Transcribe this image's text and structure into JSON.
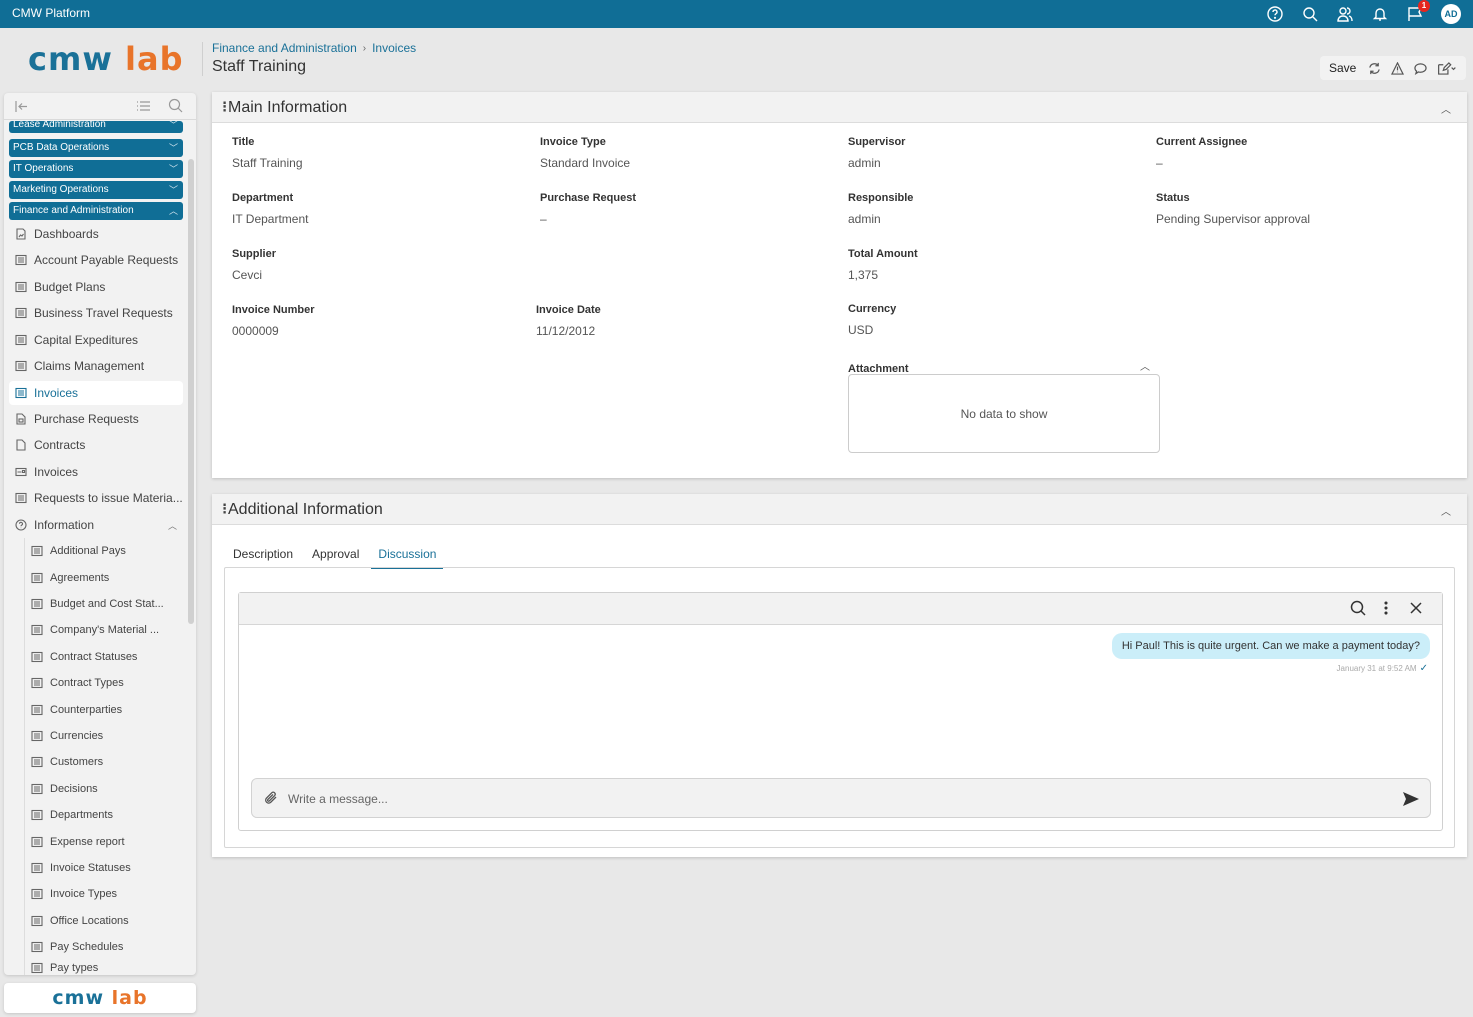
{
  "topbar": {
    "app_title": "CMW Platform",
    "icons": [
      "help-icon",
      "search-icon",
      "users-icon",
      "bell-icon",
      "flag-icon"
    ],
    "notification_count": "1",
    "avatar_initials": "AD"
  },
  "logo": {
    "part1": "cmw",
    "part2": "lab"
  },
  "breadcrumb": {
    "items": [
      "Finance and Administration",
      "Invoices"
    ],
    "separator": "›"
  },
  "page_title": "Staff Training",
  "actions": {
    "save_label": "Save"
  },
  "sidebar": {
    "groups": [
      {
        "label": "Lease Administration",
        "expanded": false
      },
      {
        "label": "PCB Data Operations",
        "expanded": false
      },
      {
        "label": "IT Operations",
        "expanded": false
      },
      {
        "label": "Marketing Operations",
        "expanded": false
      },
      {
        "label": "Finance and Administration",
        "expanded": true
      }
    ],
    "items": [
      {
        "label": "Dashboards",
        "icon": "dashboard-icon"
      },
      {
        "label": "Account Payable Requests",
        "icon": "list-icon"
      },
      {
        "label": "Budget Plans",
        "icon": "list-icon"
      },
      {
        "label": "Business Travel Requests",
        "icon": "list-icon"
      },
      {
        "label": "Capital Expeditures",
        "icon": "list-icon"
      },
      {
        "label": "Claims Management",
        "icon": "list-icon"
      },
      {
        "label": "Invoices",
        "icon": "list-icon",
        "active": true
      },
      {
        "label": "Purchase Requests",
        "icon": "document-icon"
      },
      {
        "label": "Contracts",
        "icon": "page-icon"
      },
      {
        "label": "Invoices",
        "icon": "card-icon"
      },
      {
        "label": "Requests to issue Materia...",
        "icon": "list-icon"
      },
      {
        "label": "Information",
        "icon": "help-circle-icon",
        "expanded": true
      }
    ],
    "sub_items": [
      "Additional Pays",
      "Agreements",
      "Budget and Cost Stat...",
      "Company's Material ...",
      "Contract Statuses",
      "Contract Types",
      "Counterparties",
      "Currencies",
      "Customers",
      "Decisions",
      "Departments",
      "Expense report",
      "Invoice Statuses",
      "Invoice Types",
      "Office Locations",
      "Pay Schedules",
      "Pay types"
    ]
  },
  "main_info": {
    "title": "Main Information",
    "fields": {
      "title": {
        "label": "Title",
        "value": "Staff Training"
      },
      "invoice_type": {
        "label": "Invoice Type",
        "value": "Standard Invoice"
      },
      "supervisor": {
        "label": "Supervisor",
        "value": "admin"
      },
      "current_assignee": {
        "label": "Current Assignee",
        "value": "–"
      },
      "department": {
        "label": "Department",
        "value": "IT Department"
      },
      "purchase_request": {
        "label": "Purchase Request",
        "value": "–"
      },
      "responsible": {
        "label": "Responsible",
        "value": "admin"
      },
      "status": {
        "label": "Status",
        "value": "Pending Supervisor approval"
      },
      "supplier": {
        "label": "Supplier",
        "value": "Cevci"
      },
      "total_amount": {
        "label": "Total Amount",
        "value": "1,375"
      },
      "invoice_number": {
        "label": "Invoice Number",
        "value": "0000009"
      },
      "invoice_date": {
        "label": "Invoice Date",
        "value": "11/12/2012"
      },
      "currency": {
        "label": "Currency",
        "value": "USD"
      }
    },
    "attachment": {
      "label": "Attachment",
      "empty_text": "No data to show"
    }
  },
  "additional_info": {
    "title": "Additional Information",
    "tabs": [
      {
        "label": "Description",
        "active": false
      },
      {
        "label": "Approval",
        "active": false
      },
      {
        "label": "Discussion",
        "active": true
      }
    ],
    "discussion": {
      "messages": [
        {
          "text": "Hi Paul! This is quite urgent. Can we make a payment today?",
          "time": "January 31 at 9:52 AM",
          "read": true
        }
      ],
      "composer_placeholder": "Write a message...",
      "composer_value": ""
    }
  },
  "colors": {
    "brand": "#106e96",
    "accent_orange": "#e8742a",
    "bubble": "#cbeef9",
    "badge": "#e5261f"
  }
}
